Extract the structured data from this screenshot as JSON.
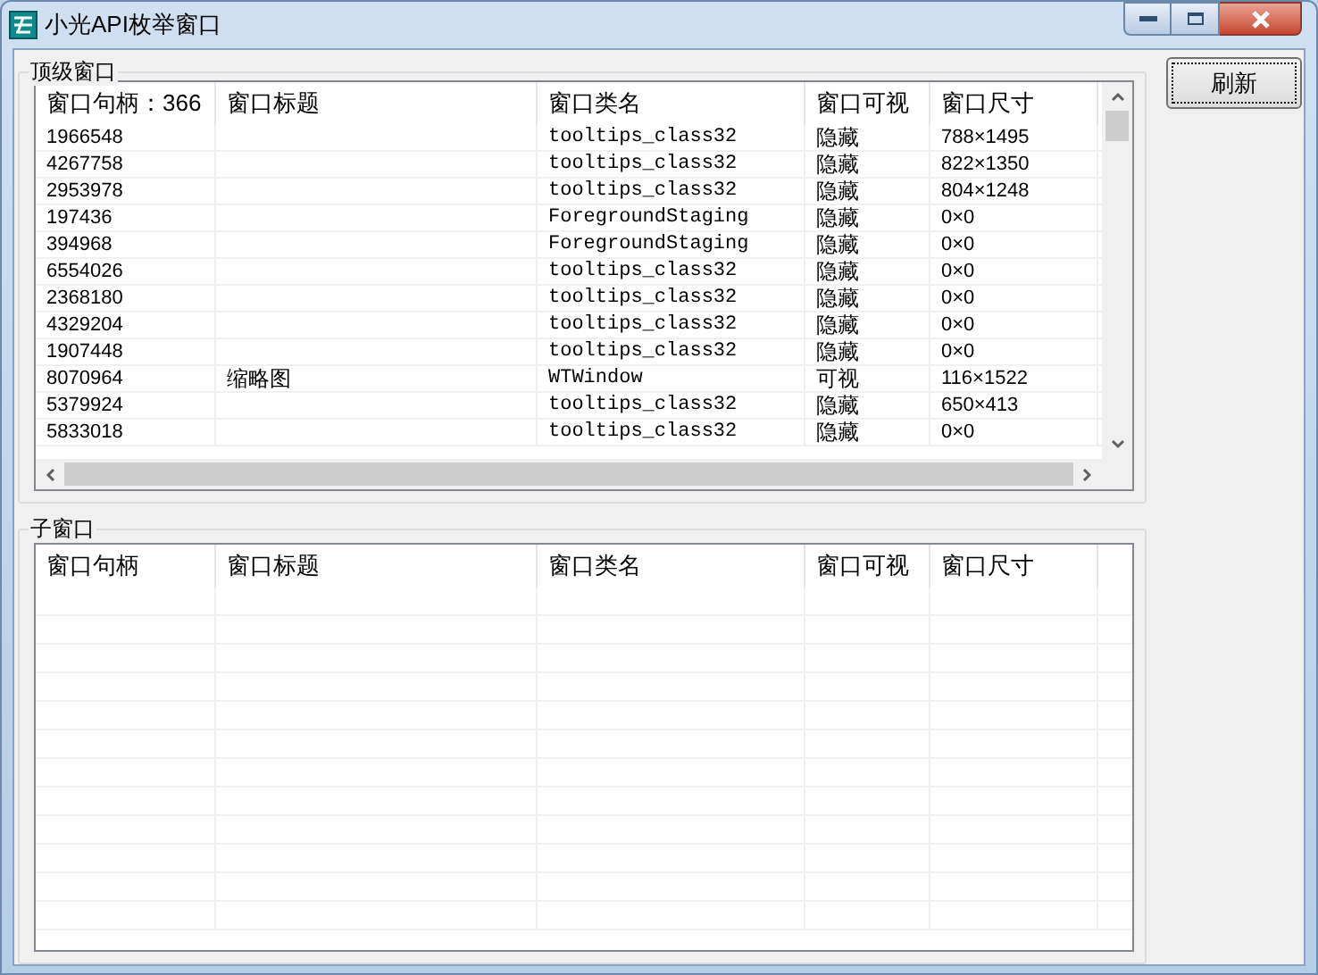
{
  "window": {
    "title": "小光API枚举窗口"
  },
  "top_group": {
    "label": "顶级窗口",
    "columns": [
      "窗口句柄：366",
      "窗口标题",
      "窗口类名",
      "窗口可视",
      "窗口尺寸"
    ],
    "rows": [
      {
        "handle": "1966548",
        "title": "",
        "class": "tooltips_class32",
        "visible": "隐藏",
        "size": "788×1495"
      },
      {
        "handle": "4267758",
        "title": "",
        "class": "tooltips_class32",
        "visible": "隐藏",
        "size": "822×1350"
      },
      {
        "handle": "2953978",
        "title": "",
        "class": "tooltips_class32",
        "visible": "隐藏",
        "size": "804×1248"
      },
      {
        "handle": "197436",
        "title": "",
        "class": "ForegroundStaging",
        "visible": "隐藏",
        "size": "0×0"
      },
      {
        "handle": "394968",
        "title": "",
        "class": "ForegroundStaging",
        "visible": "隐藏",
        "size": "0×0"
      },
      {
        "handle": "6554026",
        "title": "",
        "class": "tooltips_class32",
        "visible": "隐藏",
        "size": "0×0"
      },
      {
        "handle": "2368180",
        "title": "",
        "class": "tooltips_class32",
        "visible": "隐藏",
        "size": "0×0"
      },
      {
        "handle": "4329204",
        "title": "",
        "class": "tooltips_class32",
        "visible": "隐藏",
        "size": "0×0"
      },
      {
        "handle": "1907448",
        "title": "",
        "class": "tooltips_class32",
        "visible": "隐藏",
        "size": "0×0"
      },
      {
        "handle": "8070964",
        "title": "缩略图",
        "class": "WTWindow",
        "visible": "可视",
        "size": "116×1522"
      },
      {
        "handle": "5379924",
        "title": "",
        "class": "tooltips_class32",
        "visible": "隐藏",
        "size": "650×413"
      },
      {
        "handle": "5833018",
        "title": "",
        "class": "tooltips_class32",
        "visible": "隐藏",
        "size": "0×0"
      }
    ]
  },
  "child_group": {
    "label": "子窗口",
    "columns": [
      "窗口句柄",
      "窗口标题",
      "窗口类名",
      "窗口可视",
      "窗口尺寸"
    ]
  },
  "refresh_button": {
    "label": "刷新"
  }
}
